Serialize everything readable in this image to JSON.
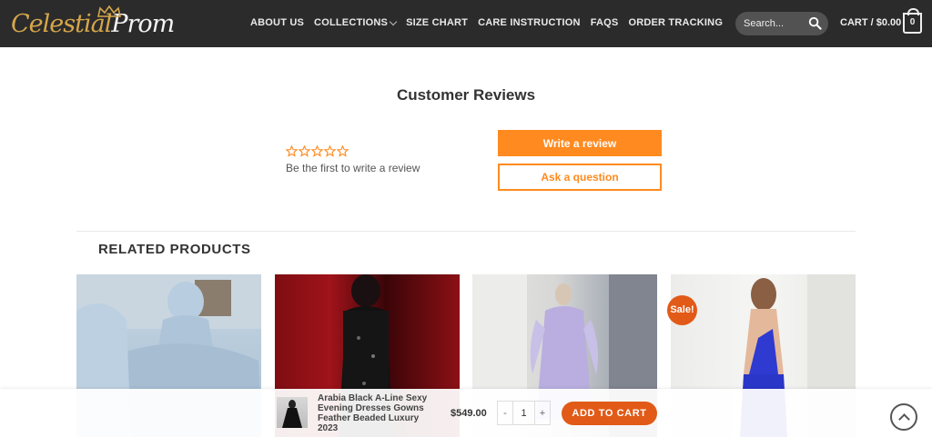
{
  "header": {
    "logo": {
      "part1": "Celestial",
      "part2": "Prom"
    },
    "nav": [
      {
        "label": "ABOUT US",
        "has_caret": false
      },
      {
        "label": "COLLECTIONS",
        "has_caret": true
      },
      {
        "label": "SIZE CHART",
        "has_caret": false
      },
      {
        "label": "CARE INSTRUCTION",
        "has_caret": false
      },
      {
        "label": "FAQS",
        "has_caret": false
      },
      {
        "label": "ORDER TRACKING",
        "has_caret": false
      }
    ],
    "search_placeholder": "Search...",
    "cart_label": "CART / $0.00",
    "cart_count": "0"
  },
  "reviews": {
    "title": "Customer Reviews",
    "rating": 0,
    "max_rating": 5,
    "empty_text": "Be the first to write a review",
    "write_label": "Write a review",
    "ask_label": "Ask a question"
  },
  "related": {
    "title": "RELATED PRODUCTS",
    "products": [
      {
        "image": "light blue ball gown"
      },
      {
        "image": "black sequin gown"
      },
      {
        "image": "lavender gown on mannequin"
      },
      {
        "image": "blue backless dress",
        "badge": "Sale!"
      }
    ]
  },
  "sticky": {
    "product_name": "Arabia Black A-Line Sexy Evening Dresses Gowns Feather Beaded Luxury 2023",
    "price": "$549.00",
    "quantity": "1",
    "minus": "-",
    "plus": "+",
    "add_label": "ADD TO CART"
  },
  "colors": {
    "header_bg": "#2b2b2b",
    "accent_orange": "#ff8a1f",
    "add_to_cart": "#e15a17",
    "logo_gold": "#d6a64b"
  }
}
